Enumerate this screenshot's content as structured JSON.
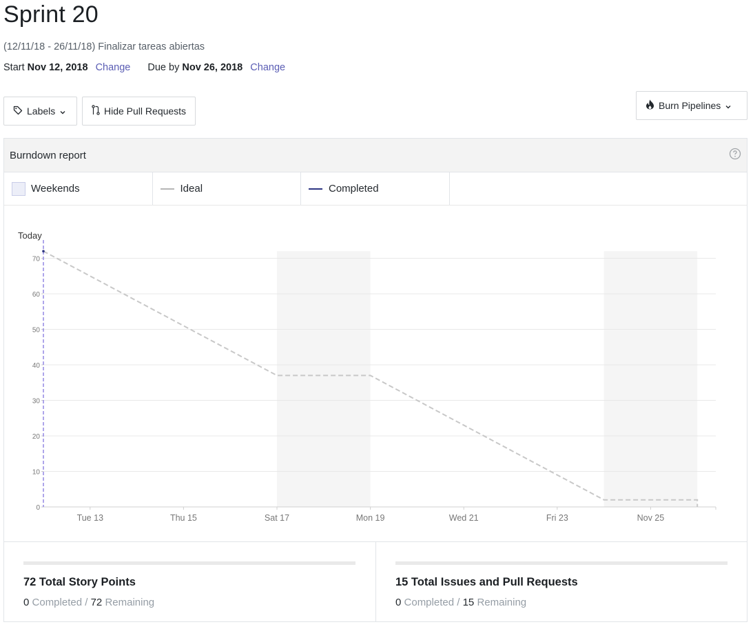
{
  "sprint": {
    "title": "Sprint 20",
    "subtitle": "(12/11/18 - 26/11/18) Finalizar tareas abiertas",
    "start_label": "Start",
    "start_date": "Nov 12, 2018",
    "change_label": "Change",
    "due_label": "Due by",
    "due_date": "Nov 26, 2018"
  },
  "toolbar": {
    "labels_button": "Labels",
    "hide_pr_button": "Hide Pull Requests",
    "burn_pipelines_button": "Burn Pipelines"
  },
  "report": {
    "title": "Burndown report",
    "legend": {
      "weekends": "Weekends",
      "ideal": "Ideal",
      "completed": "Completed"
    }
  },
  "colors": {
    "ideal": "#c8c8c8",
    "completed": "#2d3582",
    "today": "#8b7fe0",
    "weekend": "#f5f5f5",
    "link": "#5a5db4"
  },
  "chart_data": {
    "type": "line",
    "today_label": "Today",
    "x_tick_labels": [
      "Tue 13",
      "Thu 15",
      "Sat 17",
      "Mon 19",
      "Wed 21",
      "Fri 23",
      "Nov 25"
    ],
    "x_range": [
      "Nov 12",
      "Nov 26"
    ],
    "ylim": [
      0,
      72
    ],
    "y_ticks": [
      0,
      10,
      20,
      30,
      40,
      50,
      60,
      70
    ],
    "weekends": [
      [
        "Nov 17",
        "Nov 19"
      ],
      [
        "Nov 24",
        "Nov 26"
      ]
    ],
    "series": [
      {
        "name": "Ideal",
        "style": "dashed",
        "points": [
          {
            "x": "Nov 12",
            "y": 72
          },
          {
            "x": "Nov 17",
            "y": 37
          },
          {
            "x": "Nov 19",
            "y": 37
          },
          {
            "x": "Nov 24",
            "y": 2
          },
          {
            "x": "Nov 26",
            "y": 2
          },
          {
            "x": "Nov 26",
            "y": 0
          }
        ]
      },
      {
        "name": "Completed",
        "style": "solid",
        "points": [
          {
            "x": "Nov 12",
            "y": 72
          }
        ]
      }
    ],
    "grid": true
  },
  "stats": {
    "story_points": {
      "title": "72 Total Story Points",
      "completed": "0",
      "completed_label": "Completed",
      "remaining": "72",
      "remaining_label": "Remaining"
    },
    "issues": {
      "title": "15 Total Issues and Pull Requests",
      "completed": "0",
      "completed_label": "Completed",
      "remaining": "15",
      "remaining_label": "Remaining"
    }
  }
}
